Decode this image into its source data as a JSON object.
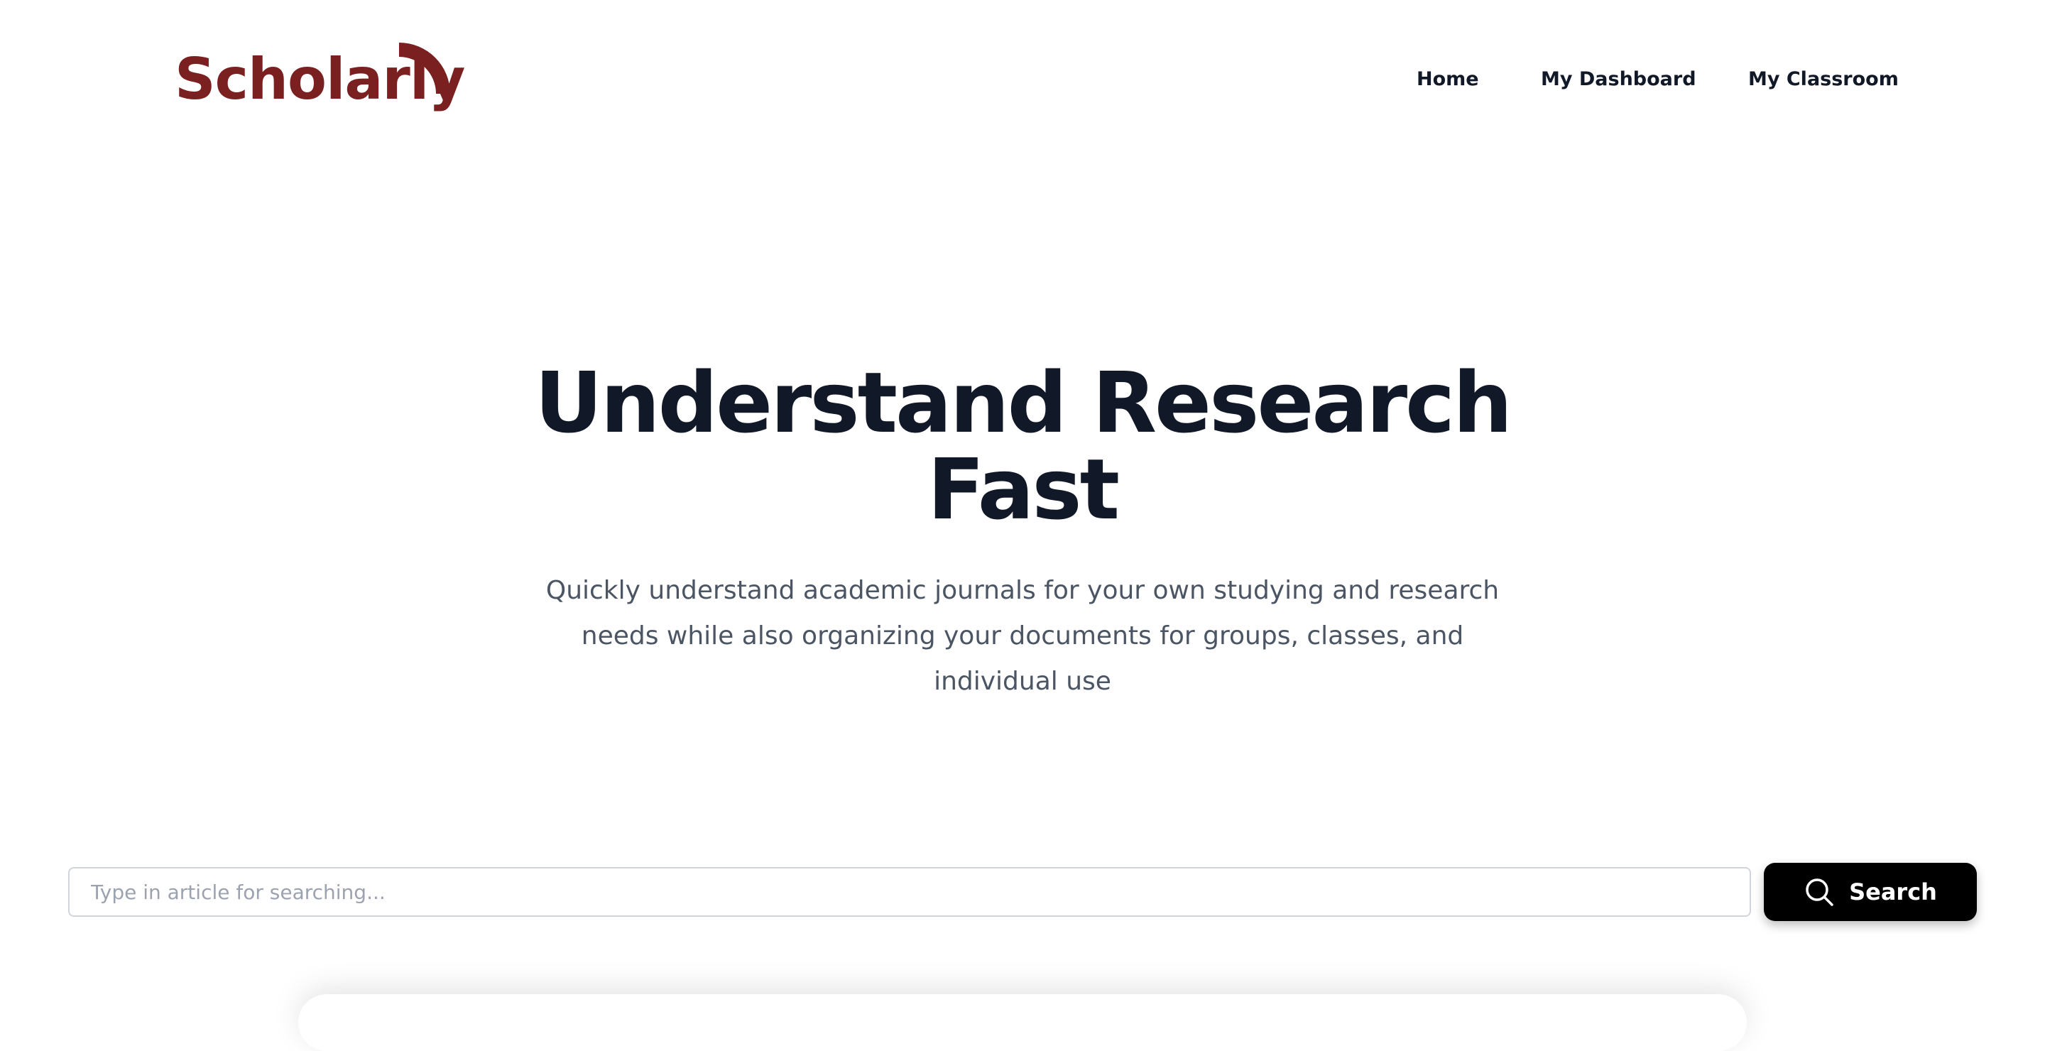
{
  "brand": {
    "name": "Scholarly",
    "color": "#7b2020"
  },
  "nav": {
    "items": [
      {
        "label": "Home"
      },
      {
        "label": "My Dashboard"
      },
      {
        "label": "My Classroom"
      }
    ]
  },
  "hero": {
    "title_line1": "Understand Research",
    "title_line2": "Fast",
    "subtitle": "Quickly understand academic journals for your own studying and research needs while also organizing your documents for groups, classes, and individual use"
  },
  "search": {
    "placeholder": "Type in article for searching...",
    "value": "",
    "button_label": "Search",
    "icon": "search-icon"
  },
  "colors": {
    "text_dark": "#111827",
    "text_muted": "#4b5563",
    "button_bg": "#000000"
  }
}
